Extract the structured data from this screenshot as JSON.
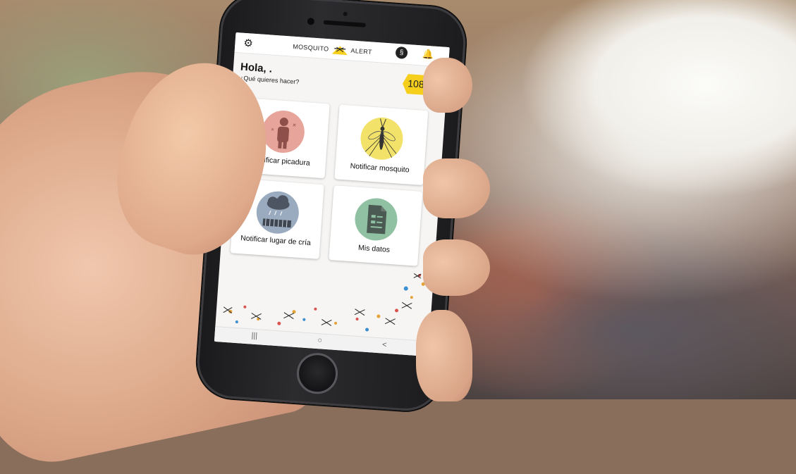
{
  "app": {
    "brand_left": "MOSQUITO",
    "brand_right": "ALERT",
    "settings_icon": "gear-icon",
    "dna_icon": "dna-icon",
    "notifications_icon": "bell-icon"
  },
  "greeting": {
    "title": "Hola, .",
    "subtitle": "¿Qué quieres hacer?",
    "points": "108"
  },
  "actions": [
    {
      "label": "Notificar picadura",
      "icon": "bitten-person-icon",
      "color": "#e7a49a"
    },
    {
      "label": "Notificar mosquito",
      "icon": "mosquito-icon",
      "color": "#f3e26a"
    },
    {
      "label": "Notificar lugar de cría",
      "icon": "rain-cloud-icon",
      "color": "#9aaabf"
    },
    {
      "label": "Mis datos",
      "icon": "document-icon",
      "color": "#8fc1a2"
    }
  ],
  "navbar": {
    "recents": "|||",
    "home": "○",
    "back": "<"
  },
  "colors": {
    "points_badge": "#f5cf1c",
    "screen_bg": "#f6f5f3"
  }
}
